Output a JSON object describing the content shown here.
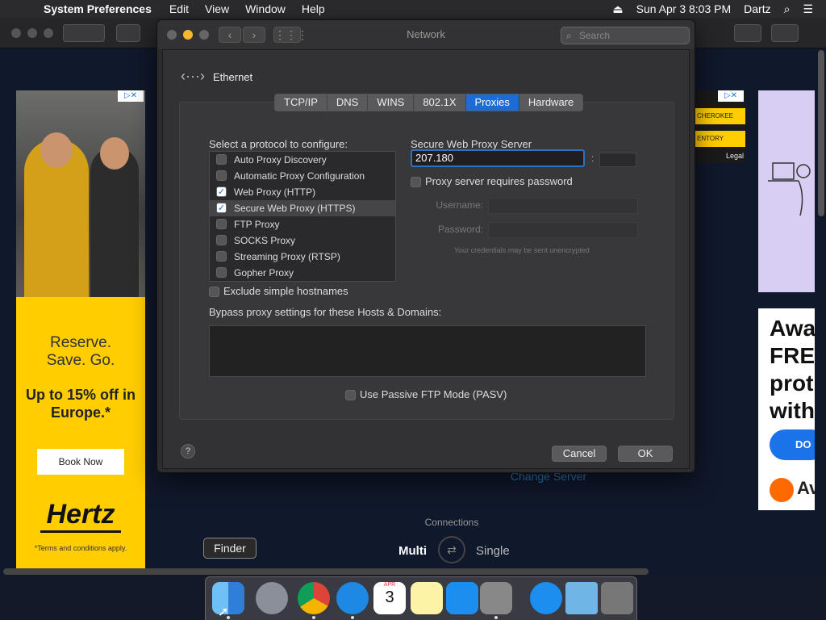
{
  "menubar": {
    "app": "System Preferences",
    "items": [
      "Edit",
      "View",
      "Window",
      "Help"
    ],
    "clock": "Sun Apr 3  8:03 PM",
    "user": "Dartz"
  },
  "window": {
    "title": "Network",
    "search_placeholder": "Search"
  },
  "sheet": {
    "interface": "Ethernet",
    "tabs": [
      "TCP/IP",
      "DNS",
      "WINS",
      "802.1X",
      "Proxies",
      "Hardware"
    ],
    "active_tab": "Proxies",
    "protocol_label": "Select a protocol to configure:",
    "protocols": [
      {
        "label": "Auto Proxy Discovery",
        "checked": false
      },
      {
        "label": "Automatic Proxy Configuration",
        "checked": false
      },
      {
        "label": "Web Proxy (HTTP)",
        "checked": true
      },
      {
        "label": "Secure Web Proxy (HTTPS)",
        "checked": true,
        "selected": true
      },
      {
        "label": "FTP Proxy",
        "checked": false
      },
      {
        "label": "SOCKS Proxy",
        "checked": false
      },
      {
        "label": "Streaming Proxy (RTSP)",
        "checked": false
      },
      {
        "label": "Gopher Proxy",
        "checked": false
      }
    ],
    "server_title": "Secure Web Proxy Server",
    "server_value": "207.180",
    "port_value": "",
    "requires_password": "Proxy server requires password",
    "username_label": "Username:",
    "password_label": "Password:",
    "cred_warning": "Your credentials may be sent unencrypted",
    "exclude_simple": "Exclude simple hostnames",
    "bypass_label": "Bypass proxy settings for these Hosts & Domains:",
    "bypass_value": "",
    "pasv": "Use Passive FTP Mode (PASV)",
    "cancel": "Cancel",
    "ok": "OK",
    "help": "?"
  },
  "background": {
    "change_server": "Change Server",
    "connections": "Connections",
    "multi": "Multi",
    "single": "Single"
  },
  "ads": {
    "left_headline": "Reserve.\nSave. Go.",
    "left_offer": "Up to 15% off in Europe.*",
    "left_button": "Book Now",
    "left_logo": "Hertz",
    "left_terms": "*Terms and conditions apply.",
    "mid_line1": "CHEROKEE",
    "mid_line2": "ENTORY",
    "mid_legal": "Legal",
    "right_headline": "Awa\nFRE\nprot\nwith",
    "right_button": "DO",
    "right_brand": "Av"
  },
  "dock": {
    "tooltip": "Finder",
    "apps": [
      "finder-icon",
      "launchpad-icon",
      "chrome-icon",
      "safari-icon",
      "calendar-icon",
      "notes-icon",
      "app-store-icon",
      "system-preferences-icon",
      "app-store-downloads-icon",
      "folder-icon",
      "trash-icon"
    ],
    "calendar_month": "APR",
    "calendar_day": "3"
  }
}
